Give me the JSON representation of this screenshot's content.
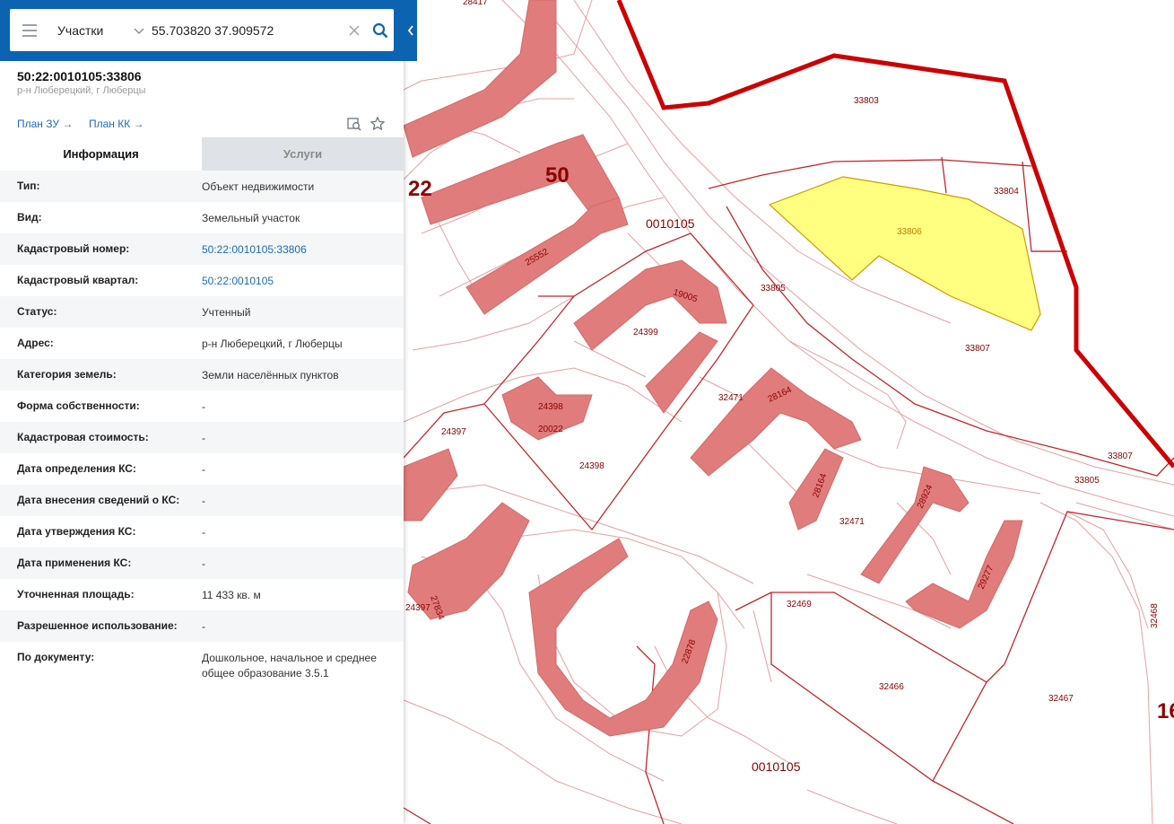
{
  "search": {
    "layer": "Участки",
    "query": "55.703820 37.909572"
  },
  "parcel": {
    "cad_number": "50:22:0010105:33806",
    "address_short": "р-н Люберецкий, г Люберцы",
    "plan_zu": "План ЗУ →",
    "plan_kk": "План КК →"
  },
  "tabs": [
    {
      "label": "Информация",
      "active": true
    },
    {
      "label": "Услуги",
      "active": false
    }
  ],
  "info_rows": [
    {
      "key": "Тип:",
      "value": "Объект недвижимости"
    },
    {
      "key": "Вид:",
      "value": "Земельный участок"
    },
    {
      "key": "Кадастровый номер:",
      "value": "50:22:0010105:33806"
    },
    {
      "key": "Кадастровый квартал:",
      "value": "50:22:0010105"
    },
    {
      "key": "Статус:",
      "value": "Учтенный"
    },
    {
      "key": "Адрес:",
      "value": "р-н Люберецкий, г Люберцы"
    },
    {
      "key": "Категория земель:",
      "value": "Земли населённых пунктов"
    },
    {
      "key": "Форма собственности:",
      "value": "-"
    },
    {
      "key": "Кадастровая стоимость:",
      "value": "-"
    },
    {
      "key": "Дата определения КС:",
      "value": "-"
    },
    {
      "key": "Дата внесения сведений о КС:",
      "value": "-"
    },
    {
      "key": "Дата утверждения КС:",
      "value": "-"
    },
    {
      "key": "Дата применения КС:",
      "value": "-"
    },
    {
      "key": "Уточненная площадь:",
      "value": "11 433 кв. м"
    },
    {
      "key": "Разрешенное использование:",
      "value": "-"
    },
    {
      "key": "По документу:",
      "value": "Дошкольное, начальное и среднее общее образование 3.5.1"
    }
  ],
  "map_labels": {
    "district_50": "50",
    "district_22": "22",
    "district_16": "16",
    "quarter_top": "0010105",
    "quarter_bottom": "0010105",
    "p33803": "33803",
    "p33804": "33804",
    "p33806": "33806",
    "p33805a": "33805",
    "p33805b": "33805",
    "p33807a": "33807",
    "p33807b": "33807",
    "p25552": "25552",
    "p19005": "19005",
    "p24399": "24399",
    "p24398a": "24398",
    "p24398b": "24398",
    "p20022": "20022",
    "p24397a": "24397",
    "p24397b": "24397",
    "p32471a": "32471",
    "p32471b": "32471",
    "p28164a": "28164",
    "p28164b": "28164",
    "p28924": "28924",
    "p29277": "29277",
    "p32469": "32469",
    "p32466": "32466",
    "p32467": "32467",
    "p32468": "32468",
    "p22878": "22878",
    "p28417": "28417",
    "p27834": "27834"
  },
  "colors": {
    "brand": "#0c64b0",
    "selected_fill": "#ffff80",
    "selected_stroke": "#d19a00",
    "district_border": "#cc0000",
    "building": "#e07c7c",
    "link": "#1b6eb5"
  }
}
